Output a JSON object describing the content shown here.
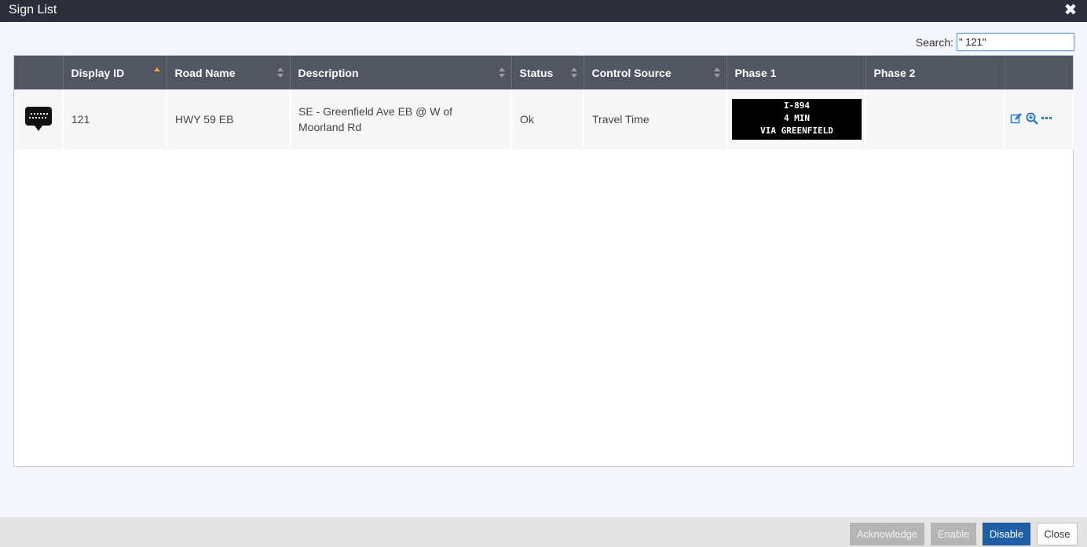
{
  "window": {
    "title": "Sign List"
  },
  "search": {
    "label": "Search:",
    "value": "\" 121\""
  },
  "table": {
    "columns": [
      {
        "label": ""
      },
      {
        "label": "Display ID",
        "sort": "asc"
      },
      {
        "label": "Road Name",
        "sort": "both"
      },
      {
        "label": "Description",
        "sort": "both"
      },
      {
        "label": "Status",
        "sort": "both"
      },
      {
        "label": "Control Source",
        "sort": "both"
      },
      {
        "label": "Phase 1"
      },
      {
        "label": "Phase 2"
      },
      {
        "label": ""
      }
    ],
    "rows": [
      {
        "icon": "sign-display-icon",
        "display_id": "121",
        "road_name": "HWY 59 EB",
        "description": "SE - Greenfield Ave EB @ W of Moorland Rd",
        "status": "Ok",
        "control_source": "Travel Time",
        "phase1": {
          "line1": "I-894",
          "line2": "4 MIN",
          "line3": "VIA GREENFIELD"
        },
        "phase2": "",
        "actions": [
          "edit-icon",
          "zoom-in-icon",
          "more-icon"
        ]
      }
    ]
  },
  "footer": {
    "acknowledge_label": "Acknowledge",
    "enable_label": "Enable",
    "disable_label": "Disable",
    "close_label": "Close"
  },
  "colors": {
    "titlebar": "#2c2f3a",
    "header": "#525660",
    "primary_button": "#1f5fa6",
    "link_icon": "#2a7ac7",
    "sort_active": "#f0a030"
  }
}
